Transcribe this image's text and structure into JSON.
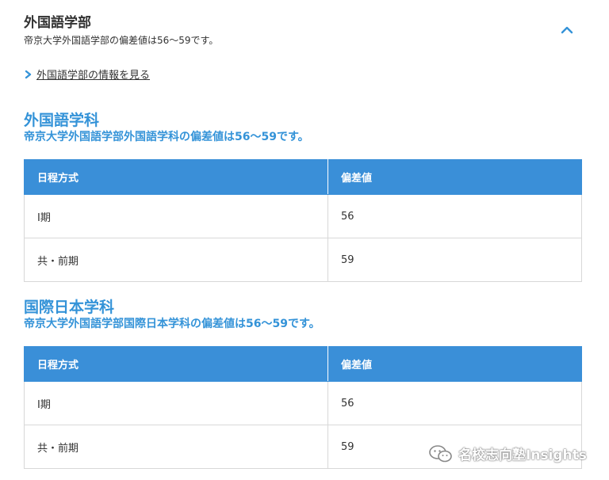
{
  "faculty": {
    "title": "外国語学部",
    "subtitle": "帝京大学外国語学部の偏差値は56〜59です。",
    "link_label": "外国語学部の情報を見る"
  },
  "departments": [
    {
      "title": "外国語学科",
      "note": "帝京大学外国語学部外国語学科の偏差値は56〜59です。",
      "headers": [
        "日程方式",
        "偏差値"
      ],
      "rows": [
        [
          "Ⅰ期",
          "56"
        ],
        [
          "共・前期",
          "59"
        ]
      ]
    },
    {
      "title": "国際日本学科",
      "note": "帝京大学外国語学部国際日本学科の偏差値は56〜59です。",
      "headers": [
        "日程方式",
        "偏差値"
      ],
      "rows": [
        [
          "Ⅰ期",
          "56"
        ],
        [
          "共・前期",
          "59"
        ]
      ]
    }
  ],
  "watermark": {
    "text": "名校志向塾Insights",
    "icon": "wechat-icon"
  },
  "colors": {
    "accent": "#3493d8",
    "table_header": "#3a8fd8",
    "border": "#d8d8d8",
    "text": "#333333"
  }
}
